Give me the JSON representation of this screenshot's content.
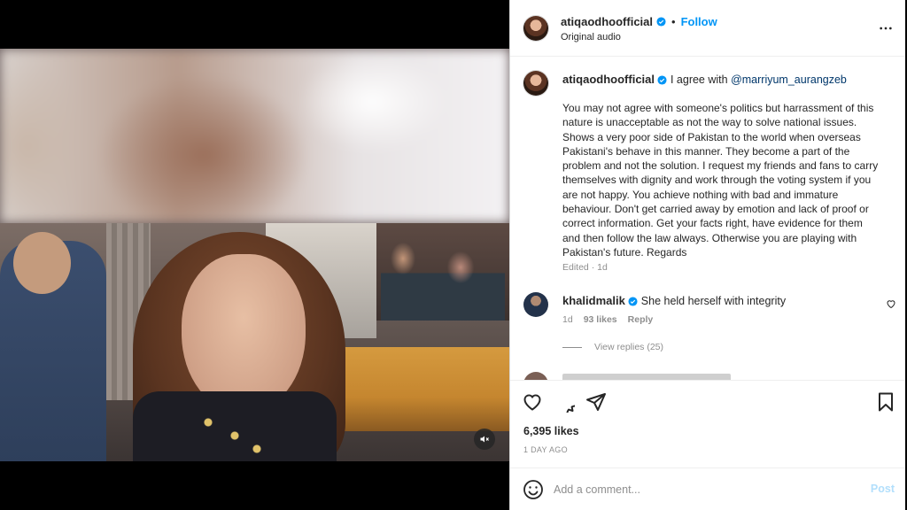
{
  "post": {
    "username": "atiqaodhoofficial",
    "follow_label": "Follow",
    "audio": "Original audio",
    "separator": "•"
  },
  "caption": {
    "username": "atiqaodhoofficial",
    "intro": "I agree with",
    "mention": "@marriyum_aurangzeb",
    "body": "You may not agree with someone's politics but harrassment of this nature is unacceptable as not the way to solve national issues. Shows a very poor side of Pakistan to the world when overseas Pakistani's behave in this manner. They become a part of the problem and not the solution. I request my friends and fans to carry themselves with dignity and work through the voting system if you are not happy. You achieve nothing with bad and immature behaviour. Don't get carried away by emotion and lack of proof or correct information. Get your facts right, have evidence for them and then follow the law always. Otherwise you are playing with Pakistan's future. Regards",
    "meta": "Edited · 1d"
  },
  "comments": [
    {
      "username": "khalidmalik",
      "text": "She held herself with integrity",
      "time": "1d",
      "likes": "93 likes",
      "reply_label": "Reply",
      "view_replies": "View replies (25)"
    }
  ],
  "actions": {
    "likes": "6,395 likes",
    "time_ago": "1 DAY AGO"
  },
  "add_comment": {
    "placeholder": "Add a comment...",
    "post_label": "Post"
  },
  "icons": {
    "header": [
      "verified-badge-icon",
      "more-options-icon"
    ],
    "actions": [
      "heart-icon",
      "comment-icon",
      "share-icon",
      "bookmark-icon"
    ],
    "video": [
      "mute-icon"
    ],
    "composer": [
      "emoji-icon"
    ]
  },
  "colors": {
    "link": "#0095f6",
    "mention": "#00376b",
    "verified": "#0095f6",
    "muted_text": "#8e8e8e",
    "post_disabled": "#b2dffc"
  }
}
